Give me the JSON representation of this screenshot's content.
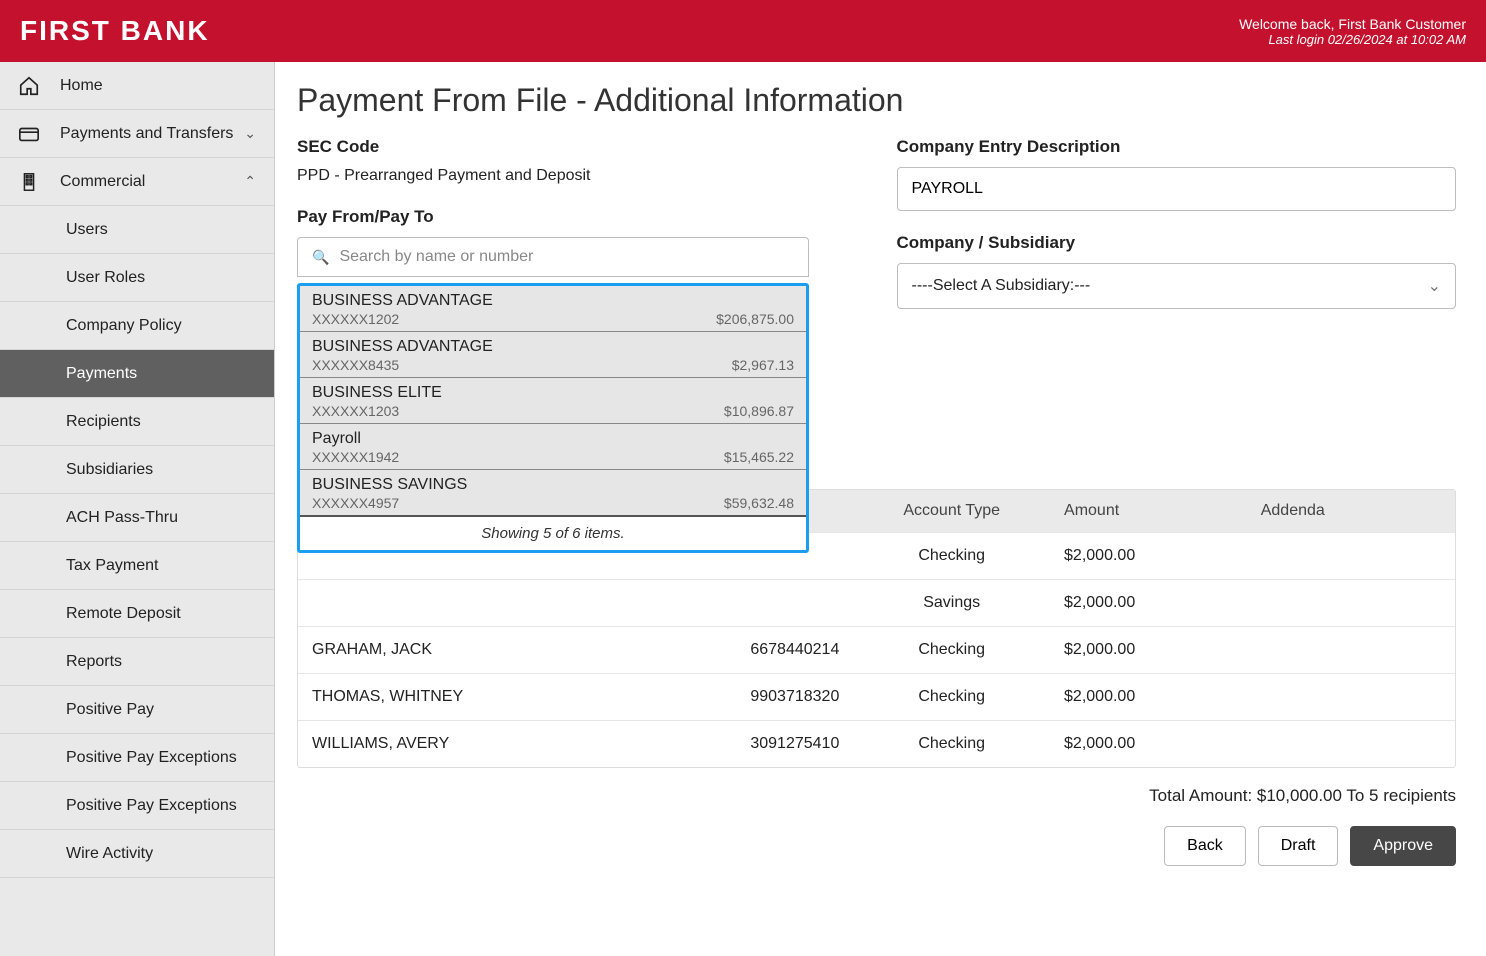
{
  "header": {
    "logo": "FIRST BANK",
    "welcome": "Welcome back, First Bank Customer",
    "last_login": "Last login 02/26/2024 at 10:02 AM"
  },
  "sidebar": {
    "home": "Home",
    "payments_transfers": "Payments and Transfers",
    "commercial": "Commercial",
    "items": [
      "Users",
      "User Roles",
      "Company Policy",
      "Payments",
      "Recipients",
      "Subsidiaries",
      "ACH Pass-Thru",
      "Tax Payment",
      "Remote Deposit",
      "Reports",
      "Positive Pay",
      "Positive Pay Exceptions",
      "Positive Pay Exceptions",
      "Wire Activity"
    ],
    "active_index": 3
  },
  "page": {
    "title": "Payment From File - Additional Information",
    "sec_code_label": "SEC Code",
    "sec_code_value": "PPD - Prearranged Payment and Deposit",
    "company_entry_label": "Company Entry Description",
    "company_entry_value": "PAYROLL",
    "pay_from_label": "Pay From/Pay To",
    "search_placeholder": "Search by name or number",
    "subsidiary_label": "Company / Subsidiary",
    "subsidiary_value": "----Select A Subsidiary:---"
  },
  "dropdown": {
    "items": [
      {
        "name": "BUSINESS ADVANTAGE",
        "num": "XXXXXX1202",
        "bal": "$206,875.00"
      },
      {
        "name": "BUSINESS ADVANTAGE",
        "num": "XXXXXX8435",
        "bal": "$2,967.13"
      },
      {
        "name": "BUSINESS ELITE",
        "num": "XXXXXX1203",
        "bal": "$10,896.87"
      },
      {
        "name": "Payroll",
        "num": "XXXXXX1942",
        "bal": "$15,465.22"
      },
      {
        "name": "BUSINESS SAVINGS",
        "num": "XXXXXX4957",
        "bal": "$59,632.48"
      }
    ],
    "footer": "Showing 5 of 6 items."
  },
  "table": {
    "headers": {
      "account_type": "Account Type",
      "amount": "Amount",
      "addenda": "Addenda"
    },
    "rows": [
      {
        "name": "GRAHAM, JACK",
        "num": "6678440214",
        "type": "Checking",
        "amount": "$2,000.00"
      },
      {
        "name": "THOMAS, WHITNEY",
        "num": "9903718320",
        "type": "Checking",
        "amount": "$2,000.00"
      },
      {
        "name": "WILLIAMS, AVERY",
        "num": "3091275410",
        "type": "Checking",
        "amount": "$2,000.00"
      }
    ],
    "hidden_rows": [
      {
        "type": "Checking",
        "amount": "$2,000.00"
      },
      {
        "type": "Savings",
        "amount": "$2,000.00"
      }
    ]
  },
  "totals": {
    "line": "Total Amount: $10,000.00 To 5 recipients"
  },
  "buttons": {
    "back": "Back",
    "draft": "Draft",
    "approve": "Approve"
  }
}
